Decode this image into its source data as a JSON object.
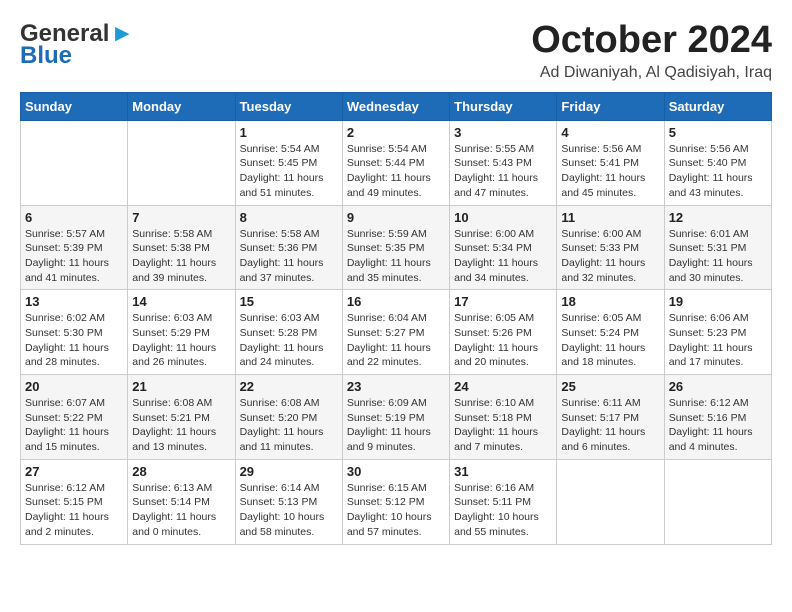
{
  "header": {
    "logo_general": "General",
    "logo_blue": "Blue",
    "title": "October 2024",
    "location": "Ad Diwaniyah, Al Qadisiyah, Iraq"
  },
  "weekdays": [
    "Sunday",
    "Monday",
    "Tuesday",
    "Wednesday",
    "Thursday",
    "Friday",
    "Saturday"
  ],
  "weeks": [
    [
      null,
      null,
      {
        "day": "1",
        "sunrise": "5:54 AM",
        "sunset": "5:45 PM",
        "daylight": "11 hours and 51 minutes."
      },
      {
        "day": "2",
        "sunrise": "5:54 AM",
        "sunset": "5:44 PM",
        "daylight": "11 hours and 49 minutes."
      },
      {
        "day": "3",
        "sunrise": "5:55 AM",
        "sunset": "5:43 PM",
        "daylight": "11 hours and 47 minutes."
      },
      {
        "day": "4",
        "sunrise": "5:56 AM",
        "sunset": "5:41 PM",
        "daylight": "11 hours and 45 minutes."
      },
      {
        "day": "5",
        "sunrise": "5:56 AM",
        "sunset": "5:40 PM",
        "daylight": "11 hours and 43 minutes."
      }
    ],
    [
      {
        "day": "6",
        "sunrise": "5:57 AM",
        "sunset": "5:39 PM",
        "daylight": "11 hours and 41 minutes."
      },
      {
        "day": "7",
        "sunrise": "5:58 AM",
        "sunset": "5:38 PM",
        "daylight": "11 hours and 39 minutes."
      },
      {
        "day": "8",
        "sunrise": "5:58 AM",
        "sunset": "5:36 PM",
        "daylight": "11 hours and 37 minutes."
      },
      {
        "day": "9",
        "sunrise": "5:59 AM",
        "sunset": "5:35 PM",
        "daylight": "11 hours and 35 minutes."
      },
      {
        "day": "10",
        "sunrise": "6:00 AM",
        "sunset": "5:34 PM",
        "daylight": "11 hours and 34 minutes."
      },
      {
        "day": "11",
        "sunrise": "6:00 AM",
        "sunset": "5:33 PM",
        "daylight": "11 hours and 32 minutes."
      },
      {
        "day": "12",
        "sunrise": "6:01 AM",
        "sunset": "5:31 PM",
        "daylight": "11 hours and 30 minutes."
      }
    ],
    [
      {
        "day": "13",
        "sunrise": "6:02 AM",
        "sunset": "5:30 PM",
        "daylight": "11 hours and 28 minutes."
      },
      {
        "day": "14",
        "sunrise": "6:03 AM",
        "sunset": "5:29 PM",
        "daylight": "11 hours and 26 minutes."
      },
      {
        "day": "15",
        "sunrise": "6:03 AM",
        "sunset": "5:28 PM",
        "daylight": "11 hours and 24 minutes."
      },
      {
        "day": "16",
        "sunrise": "6:04 AM",
        "sunset": "5:27 PM",
        "daylight": "11 hours and 22 minutes."
      },
      {
        "day": "17",
        "sunrise": "6:05 AM",
        "sunset": "5:26 PM",
        "daylight": "11 hours and 20 minutes."
      },
      {
        "day": "18",
        "sunrise": "6:05 AM",
        "sunset": "5:24 PM",
        "daylight": "11 hours and 18 minutes."
      },
      {
        "day": "19",
        "sunrise": "6:06 AM",
        "sunset": "5:23 PM",
        "daylight": "11 hours and 17 minutes."
      }
    ],
    [
      {
        "day": "20",
        "sunrise": "6:07 AM",
        "sunset": "5:22 PM",
        "daylight": "11 hours and 15 minutes."
      },
      {
        "day": "21",
        "sunrise": "6:08 AM",
        "sunset": "5:21 PM",
        "daylight": "11 hours and 13 minutes."
      },
      {
        "day": "22",
        "sunrise": "6:08 AM",
        "sunset": "5:20 PM",
        "daylight": "11 hours and 11 minutes."
      },
      {
        "day": "23",
        "sunrise": "6:09 AM",
        "sunset": "5:19 PM",
        "daylight": "11 hours and 9 minutes."
      },
      {
        "day": "24",
        "sunrise": "6:10 AM",
        "sunset": "5:18 PM",
        "daylight": "11 hours and 7 minutes."
      },
      {
        "day": "25",
        "sunrise": "6:11 AM",
        "sunset": "5:17 PM",
        "daylight": "11 hours and 6 minutes."
      },
      {
        "day": "26",
        "sunrise": "6:12 AM",
        "sunset": "5:16 PM",
        "daylight": "11 hours and 4 minutes."
      }
    ],
    [
      {
        "day": "27",
        "sunrise": "6:12 AM",
        "sunset": "5:15 PM",
        "daylight": "11 hours and 2 minutes."
      },
      {
        "day": "28",
        "sunrise": "6:13 AM",
        "sunset": "5:14 PM",
        "daylight": "11 hours and 0 minutes."
      },
      {
        "day": "29",
        "sunrise": "6:14 AM",
        "sunset": "5:13 PM",
        "daylight": "10 hours and 58 minutes."
      },
      {
        "day": "30",
        "sunrise": "6:15 AM",
        "sunset": "5:12 PM",
        "daylight": "10 hours and 57 minutes."
      },
      {
        "day": "31",
        "sunrise": "6:16 AM",
        "sunset": "5:11 PM",
        "daylight": "10 hours and 55 minutes."
      },
      null,
      null
    ]
  ]
}
